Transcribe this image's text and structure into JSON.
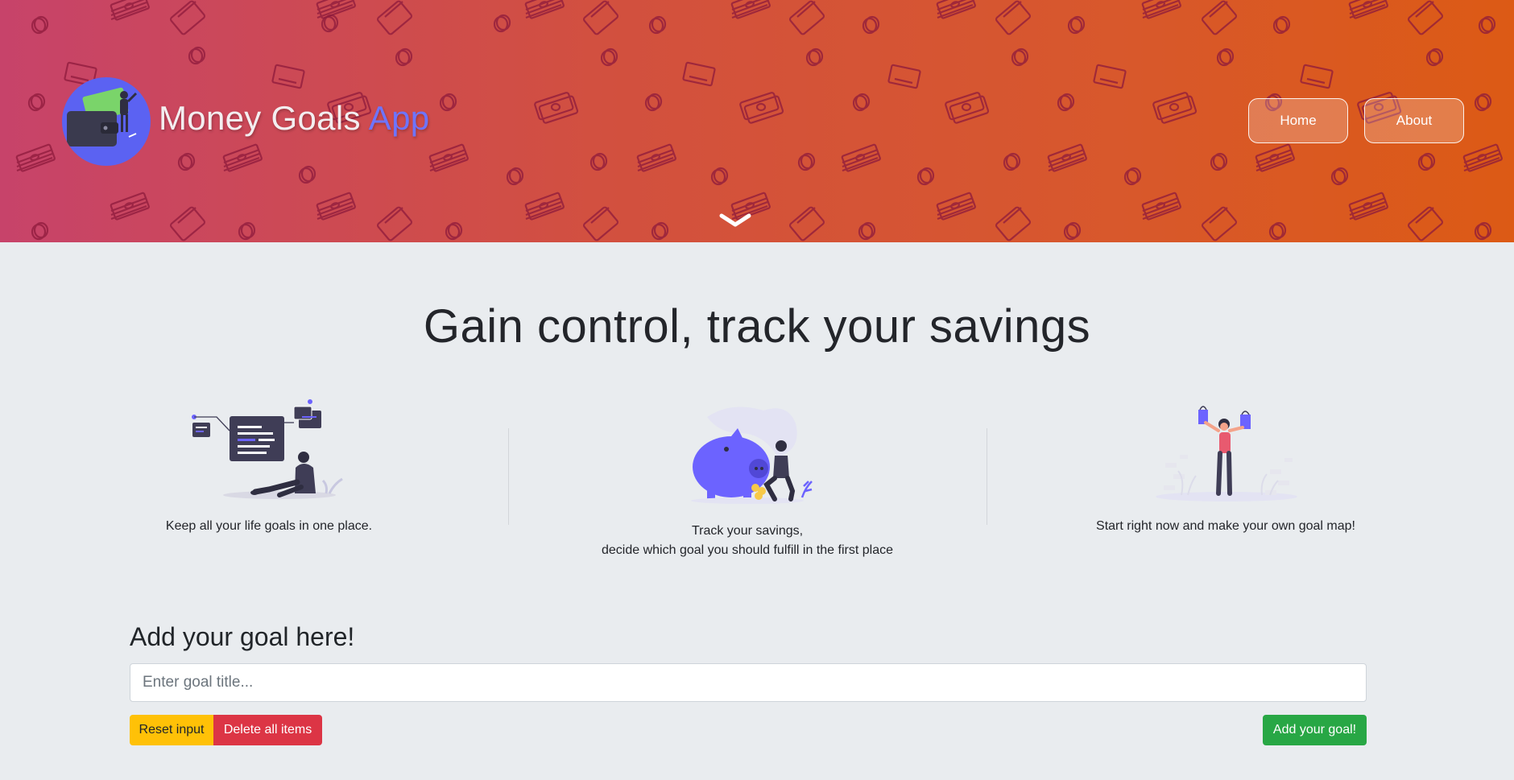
{
  "header": {
    "brand_main": "Money Goals",
    "brand_accent": "App",
    "nav": {
      "home_label": "Home",
      "about_label": "About"
    },
    "colors": {
      "gradient_start": "#c7436a",
      "gradient_end": "#dc5a15",
      "pattern": "#8e1a3c"
    }
  },
  "main": {
    "headline": "Gain control, track your savings",
    "features": [
      {
        "icon": "planning-illustration",
        "text_lines": [
          "Keep all your life goals in one place."
        ]
      },
      {
        "icon": "piggy-bank-illustration",
        "text_lines": [
          "Track your savings,",
          "decide which goal you should fulfill in the first place"
        ]
      },
      {
        "icon": "celebration-illustration",
        "text_lines": [
          "Start right now and make your own goal map!"
        ]
      }
    ]
  },
  "form": {
    "title": "Add your goal here!",
    "input_placeholder": "Enter goal title...",
    "input_value": "",
    "reset_label": "Reset input",
    "delete_label": "Delete all items",
    "add_label": "Add your goal!",
    "colors": {
      "reset": "#ffc107",
      "delete": "#dc3545",
      "add": "#28a745"
    }
  }
}
